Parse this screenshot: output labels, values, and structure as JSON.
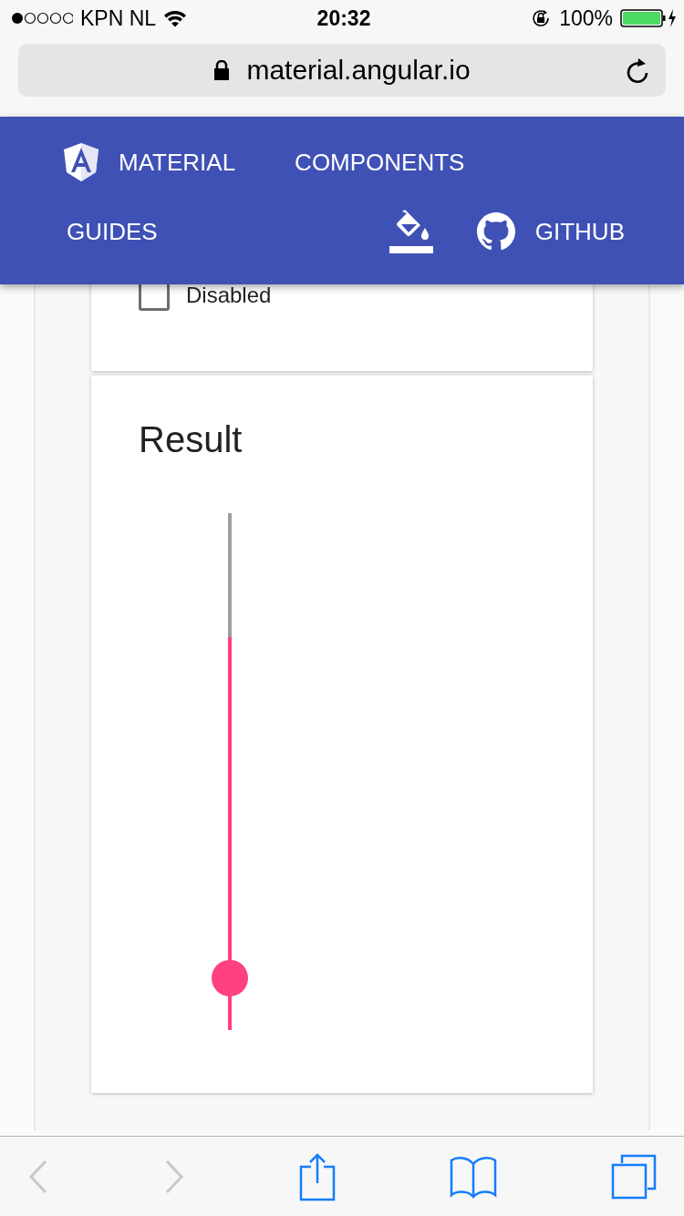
{
  "status_bar": {
    "carrier": "KPN NL",
    "time": "20:32",
    "battery": "100%"
  },
  "address_bar": {
    "url": "material.angular.io"
  },
  "nav": {
    "items": [
      {
        "kind": "logo",
        "label": "MATERIAL"
      },
      {
        "kind": "link",
        "label": "COMPONENTS"
      },
      {
        "kind": "link",
        "label": "GUIDES"
      },
      {
        "kind": "theme"
      },
      {
        "kind": "github",
        "label": "GITHUB"
      }
    ]
  },
  "options_card": {
    "checkbox": {
      "label": "Disabled",
      "checked": false
    }
  },
  "result_card": {
    "title": "Result",
    "slider": {
      "level": 0.76,
      "thumb": {
        "level": 0.1
      }
    }
  },
  "toolbar": {
    "back": {
      "disabled": true
    },
    "forward": {
      "disabled": true
    }
  }
}
